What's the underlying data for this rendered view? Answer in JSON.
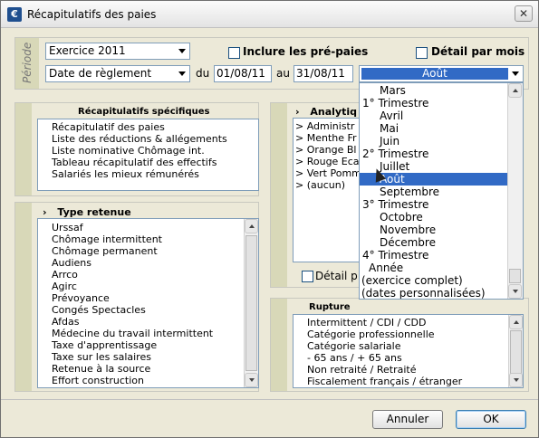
{
  "window": {
    "title": "Récapitulatifs des paies",
    "icon": "app-icon",
    "icon_glyph": "€",
    "close_glyph": "✕"
  },
  "periode": {
    "label": "Période",
    "exercice": "Exercice 2011",
    "date_type": "Date de règlement",
    "du_label": "du",
    "date_from": "01/08/11",
    "au_label": "au",
    "date_to": "31/08/11",
    "period_selected": "Août",
    "include_label": "Inclure les pré-paies",
    "detail_label": "Détail par mois"
  },
  "recap_specifiques": {
    "header": "Récapitulatifs spécifiques",
    "items": [
      "Récapitulatif des paies",
      "Liste des réductions & allégements",
      "Liste nominative Chômage int.",
      "Tableau récapitulatif des effectifs",
      "Salariés les mieux rémunérés"
    ]
  },
  "type_retenue": {
    "header": "Type retenue",
    "chevron": "›",
    "items": [
      "Urssaf",
      "Chômage intermittent",
      "Chômage permanent",
      "Audiens",
      "Arrco",
      "Agirc",
      "Prévoyance",
      "Congés Spectacles",
      "Afdas",
      "Médecine du travail intermittent",
      "Taxe d'apprentissage",
      "Taxe sur les salaires",
      "Retenue à la source",
      "Effort construction"
    ]
  },
  "analytique": {
    "header": "Analytiq",
    "chevron": "›",
    "items": [
      "> Administr",
      "> Menthe Fr",
      "> Orange Bl",
      "> Rouge Eca",
      "> Vert Pomm",
      "> (aucun)"
    ],
    "detail_label": "Détail p"
  },
  "rupture": {
    "header": "Rupture",
    "items": [
      "Intermittent / CDI / CDD",
      "Catégorie professionnelle",
      "Catégorie salariale",
      "- 65 ans / + 65 ans",
      "Non retraité / Retraité",
      "Fiscalement français / étranger"
    ]
  },
  "dropdown": {
    "items": [
      {
        "label": "Mars",
        "kind": "month"
      },
      {
        "label": "1° Trimestre",
        "kind": "trim"
      },
      {
        "label": "Avril",
        "kind": "month"
      },
      {
        "label": "Mai",
        "kind": "month"
      },
      {
        "label": "Juin",
        "kind": "month"
      },
      {
        "label": "2° Trimestre",
        "kind": "trim"
      },
      {
        "label": "Juillet",
        "kind": "month"
      },
      {
        "label": "Août",
        "kind": "month",
        "selected": true
      },
      {
        "label": "Septembre",
        "kind": "month"
      },
      {
        "label": "3° Trimestre",
        "kind": "trim"
      },
      {
        "label": "Octobre",
        "kind": "month"
      },
      {
        "label": "Novembre",
        "kind": "month"
      },
      {
        "label": "Décembre",
        "kind": "month"
      },
      {
        "label": "4° Trimestre",
        "kind": "trim"
      },
      {
        "label": "Année",
        "kind": "year"
      },
      {
        "label": "(exercice complet)",
        "kind": "paren"
      },
      {
        "label": "(dates personnalisées)",
        "kind": "paren"
      }
    ]
  },
  "buttons": {
    "cancel": "Annuler",
    "ok": "OK"
  },
  "colors": {
    "selection": "#316ac5",
    "panel_strip": "#d8d8b8",
    "window_bg": "#ece9d8"
  }
}
